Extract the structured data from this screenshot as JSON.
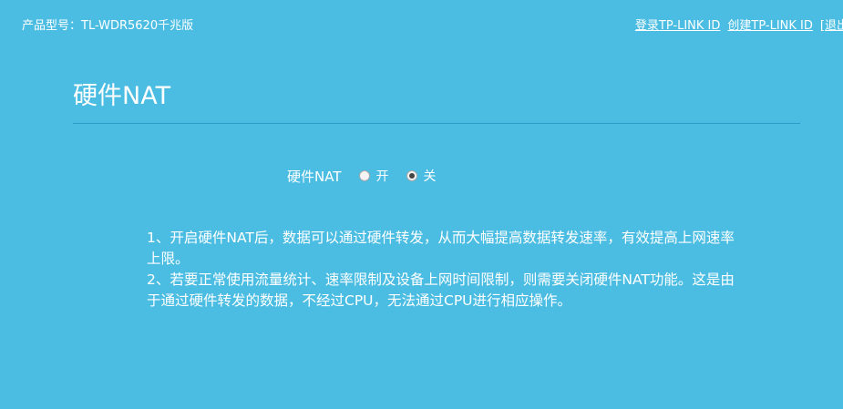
{
  "header": {
    "product_label": "产品型号：TL-WDR5620千兆版",
    "links": {
      "login": "登录TP-LINK ID",
      "create": "创建TP-LINK ID",
      "logout_bracket": "[",
      "logout": "退出"
    }
  },
  "page": {
    "title": "硬件NAT"
  },
  "nat_setting": {
    "label": "硬件NAT",
    "options": [
      {
        "label": "开",
        "checked": false
      },
      {
        "label": "关",
        "checked": true
      }
    ]
  },
  "description": {
    "line1": "1、开启硬件NAT后，数据可以通过硬件转发，从而大幅提高数据转发速率，有效提高上网速率上限。",
    "line2": "2、若要正常使用流量统计、速率限制及设备上网时间限制，则需要关闭硬件NAT功能。这是由于通过硬件转发的数据，不经过CPU，无法通过CPU进行相应操作。"
  },
  "colors": {
    "background": "#4bbde3",
    "divider": "#2e9cc8",
    "text": "#ffffff"
  }
}
